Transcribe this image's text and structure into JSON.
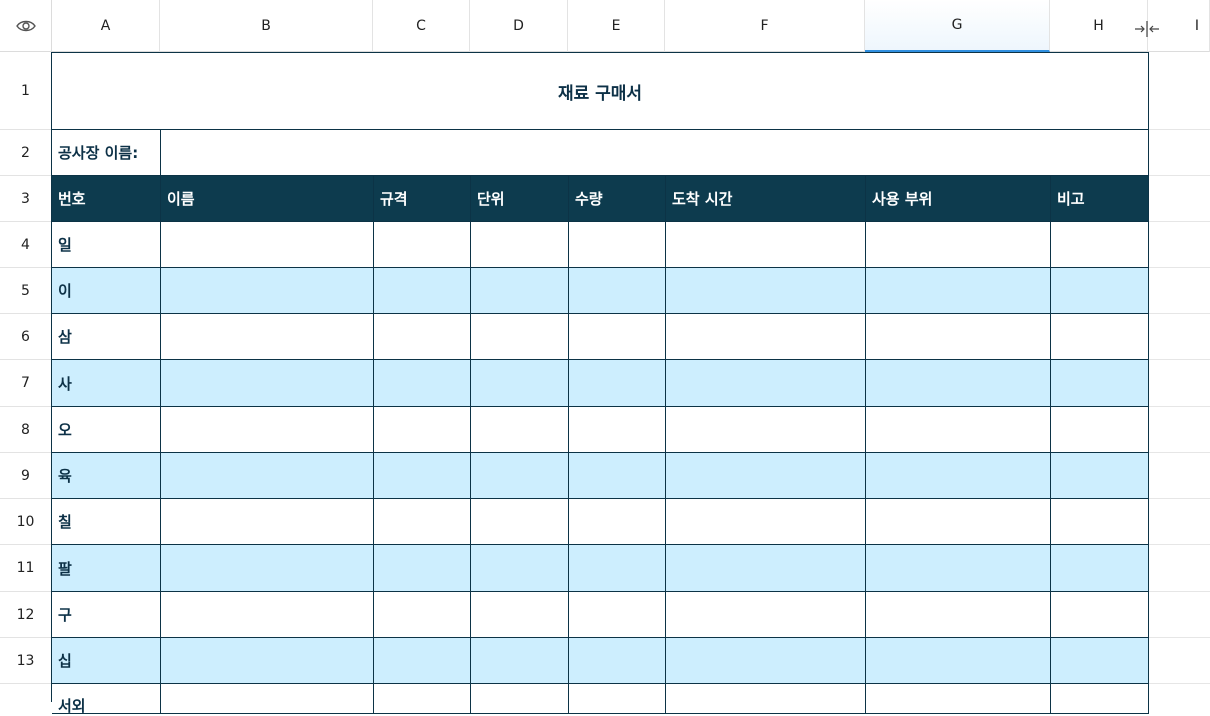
{
  "column_headers": [
    "A",
    "B",
    "C",
    "D",
    "E",
    "F",
    "G",
    "H",
    "I"
  ],
  "row_headers": [
    "1",
    "2",
    "3",
    "4",
    "5",
    "6",
    "7",
    "8",
    "9",
    "10",
    "11",
    "12",
    "13"
  ],
  "title": "재료 구매서",
  "site_label": "공사장 이름:",
  "table_headers": [
    "번호",
    "이름",
    "규격",
    "단위",
    "수량",
    "도착 시간",
    "사용 부위",
    "비고"
  ],
  "row_labels": [
    "일",
    "이",
    "삼",
    "사",
    "오",
    "육",
    "칠",
    "팔",
    "구",
    "십"
  ],
  "partial_row_label": "서외",
  "colors": {
    "header_bg": "#0d3b4e",
    "band_bg": "#cdeefe",
    "selected_col_accent": "#2f8fe0"
  },
  "icons": {
    "corner": "eye-icon",
    "column_resize": "column-resize-icon"
  }
}
